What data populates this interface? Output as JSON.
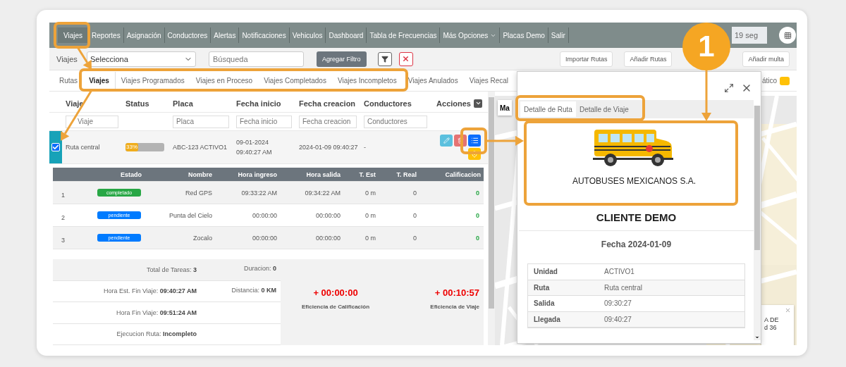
{
  "nav": {
    "items": [
      {
        "label": "Viajes",
        "selected": true,
        "dropdown": false
      },
      {
        "label": "Reportes",
        "selected": false,
        "dropdown": false
      },
      {
        "label": "Asignación",
        "selected": false,
        "dropdown": false
      },
      {
        "label": "Conductores",
        "selected": false,
        "dropdown": false
      },
      {
        "label": "Alertas",
        "selected": false,
        "dropdown": false
      },
      {
        "label": "Notificaciones",
        "selected": false,
        "dropdown": false
      },
      {
        "label": "Vehiculos",
        "selected": false,
        "dropdown": false
      },
      {
        "label": "Dashboard",
        "selected": false,
        "dropdown": false
      },
      {
        "label": "Tabla de Frecuencias",
        "selected": false,
        "dropdown": false
      },
      {
        "label": "Más Opciones",
        "selected": false,
        "dropdown": true
      },
      {
        "label": "Placas Demo",
        "selected": false,
        "dropdown": false
      },
      {
        "label": "Salir",
        "selected": false,
        "dropdown": false
      }
    ],
    "refresh_field": {
      "value": "19 seg"
    }
  },
  "filter_bar": {
    "label": "Viajes",
    "select": {
      "value": "Selecciona"
    },
    "search": {
      "placeholder": "Búsqueda"
    },
    "add_filter_button": "Agregar Filtro",
    "right_buttons": [
      "Importar Rutas",
      "Añadir Rutas",
      "Añadir multa"
    ]
  },
  "tabs": [
    {
      "label": "Rutas",
      "selected": false
    },
    {
      "label": "Viajes",
      "selected": true
    },
    {
      "label": "Viajes Programados",
      "selected": false
    },
    {
      "label": "Viajes en Proceso",
      "selected": false
    },
    {
      "label": "Viajes Completados",
      "selected": false
    },
    {
      "label": "Viajes Incompletos",
      "selected": false
    },
    {
      "label": "Viajes Anulados",
      "selected": false
    },
    {
      "label": "Viajes Recal",
      "selected": false
    }
  ],
  "legend": {
    "label": "ático"
  },
  "trips_table": {
    "columns": [
      {
        "label": "Viaje",
        "filter_placeholder": "Viaje"
      },
      {
        "label": "Status"
      },
      {
        "label": "Placa",
        "filter_placeholder": "Placa"
      },
      {
        "label": "Fecha inicio",
        "filter_placeholder": "Fecha inicio"
      },
      {
        "label": "Fecha creacion",
        "filter_placeholder": "Fecha creacion"
      },
      {
        "label": "Conductores",
        "filter_placeholder": "Conductores"
      },
      {
        "label": "Acciones"
      }
    ],
    "rows": [
      {
        "selected": true,
        "viaje": "Ruta central",
        "progress": {
          "label": "33%",
          "level": 0.33
        },
        "placa": "ABC-123 ACTIVO1",
        "fecha_inicio": "09-01-2024 09:40:27 AM",
        "fecha_creacion": "2024-01-09 09:40:27",
        "conductores": "-"
      }
    ]
  },
  "tasks_table": {
    "columns": [
      "Estado",
      "Nombre",
      "Hora ingreso",
      "Hora salida",
      "T. Est",
      "T. Real",
      "Calificacion"
    ],
    "rows": [
      {
        "index": "1",
        "estado": "completado",
        "color": "#28a745",
        "nombre": "Red GPS",
        "hora_ingreso": "09:33:22 AM",
        "hora_salida": "09:34:22 AM",
        "t_est": "0 m",
        "t_real": "0",
        "calificacion": "0"
      },
      {
        "index": "2",
        "estado": "pendiente",
        "color": "#007bff",
        "nombre": "Punta del Cielo",
        "hora_ingreso": "00:00:00",
        "hora_salida": "00:00:00",
        "t_est": "0 m",
        "t_real": "0",
        "calificacion": "0"
      },
      {
        "index": "3",
        "estado": "pendiente",
        "color": "#007bff",
        "nombre": "Zocalo",
        "hora_ingreso": "00:00:00",
        "hora_salida": "00:00:00",
        "t_est": "0 m",
        "t_real": "0",
        "calificacion": "0"
      }
    ]
  },
  "summary": {
    "left": [
      "Total de Tareas: **3**",
      "Hora Est. Fin Viaje: **09:40:27 AM**",
      "Hora Fin Viaje: **09:51:24 AM**",
      "Ejecucion Ruta: **Incompleto**"
    ],
    "middle": [
      "Duracion: **0**",
      "Distancia: **0 KM**"
    ],
    "efficiency": [
      {
        "value": "+ 00:00:00",
        "label": "Eficiencia de Calificación"
      },
      {
        "value": "+ 00:10:57",
        "label": "Eficiencia de Viaje"
      }
    ]
  },
  "map": {
    "map_type_button": "Ma",
    "info_window": {
      "lines": [
        "A DE",
        "d 36"
      ]
    }
  },
  "detail_modal": {
    "tabs": [
      {
        "label": "Detalle de Ruta",
        "selected": true
      },
      {
        "label": "Detalle de Viaje",
        "selected": false
      }
    ],
    "company": "AUTOBUSES MEXICANOS S.A.",
    "client": "CLIENTE DEMO",
    "date": "Fecha 2024-01-09",
    "details": [
      {
        "label": "Unidad",
        "value": "ACTIVO1"
      },
      {
        "label": "Ruta",
        "value": "Ruta central"
      },
      {
        "label": "Salida",
        "value": "09:30:27"
      },
      {
        "label": "Llegada",
        "value": "09:40:27"
      }
    ]
  },
  "annotations": {
    "badge": "1"
  }
}
